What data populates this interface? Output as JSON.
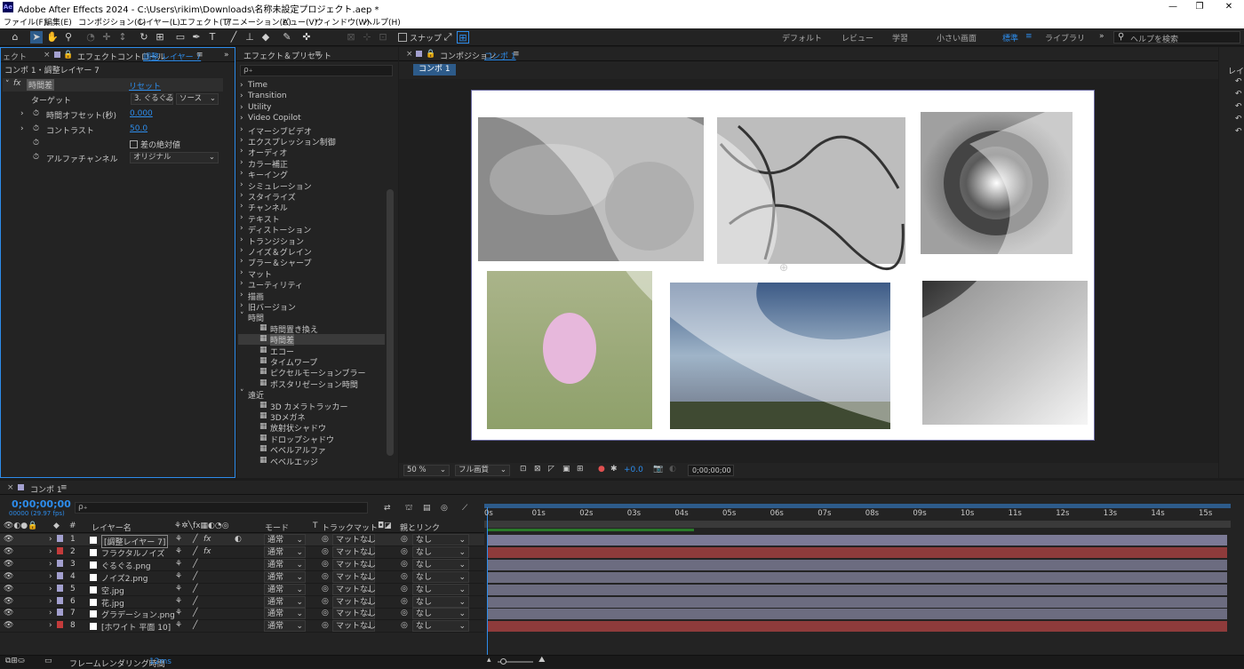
{
  "title_bar": {
    "title": "Adobe After Effects 2024 - C:\\Users\\rikim\\Downloads\\名称未設定プロジェクト.aep *",
    "logo": "Ae",
    "minimize": "—",
    "maximize": "❐",
    "close": "✕"
  },
  "menu": [
    "ファイル(F)",
    "編集(E)",
    "コンポジション(C)",
    "レイヤー(L)",
    "エフェクト(T)",
    "アニメーション(A)",
    "ビュー(V)",
    "ウィンドウ(W)",
    "ヘルプ(H)"
  ],
  "toolbar": {
    "snap_label": "スナップ",
    "workspaces": [
      "デフォルト",
      "レビュー",
      "学習",
      "小さい画面",
      "標準",
      "ライブラリ"
    ],
    "active_workspace": "標準",
    "help_search_placeholder": "ヘルプを検索"
  },
  "effect_controls": {
    "left_tab": "ェクト",
    "tab_label": "エフェクトコントロール",
    "tab_layer": "調整 レイヤー 7",
    "breadcrumb": "コンポ 1・調整レイヤー 7",
    "effect_name": "時間差",
    "reset_label": "リセット",
    "fx_label": "fx",
    "props": [
      {
        "label": "ターゲット",
        "value": "3. ぐるぐる",
        "value2": "ソース"
      },
      {
        "label": "時間オフセット(秒)",
        "value": "0.000"
      },
      {
        "label": "コントラスト",
        "value": "50.0"
      },
      {
        "label": "",
        "value": "差の絶対値"
      },
      {
        "label": "アルファチャンネル",
        "value": "オリジナル"
      }
    ]
  },
  "effects_presets": {
    "tab_label": "エフェクト＆プリセット",
    "search_placeholder": "ρ₊",
    "categories": [
      "Time",
      "Transition",
      "Utility",
      "Video Copilot",
      "イマーシブビデオ",
      "エクスプレッション制御",
      "オーディオ",
      "カラー補正",
      "キーイング",
      "シミュレーション",
      "スタイライズ",
      "チャンネル",
      "テキスト",
      "ディストーション",
      "トランジション",
      "ノイズ＆グレイン",
      "ブラー＆シャープ",
      "マット",
      "ユーティリティ",
      "描画",
      "旧バージョン"
    ],
    "expanded": "時間",
    "time_items": [
      "時間置き換え",
      "時間差",
      "エコー",
      "タイムワープ",
      "ピクセルモーションブラー",
      "ポスタリゼーション時間"
    ],
    "selected_item": "時間差",
    "obsolete_label": "遠近",
    "obsolete_items": [
      "3D カメラトラッカー",
      "3Dメガネ",
      "放射状シャドウ",
      "ドロップシャドウ",
      "ベベルアルファ",
      "ベベルエッジ"
    ]
  },
  "composition": {
    "tab_prefix": "コンポジション",
    "tab_name": "コンポ 1",
    "sub_tab": "コンポ 1",
    "zoom": "50 %",
    "resolution": "フル画質",
    "exposure": "+0.0",
    "timecode": "0;00;00;00"
  },
  "right_panel": {
    "label": "レイ"
  },
  "timeline": {
    "tab_label": "コンポ 1",
    "timecode": "0;00;00;00",
    "frame_info": "00000 (29.97 fps)",
    "search_placeholder": "ρ₊",
    "headers": {
      "num": "#",
      "name": "レイヤー名",
      "mode": "モード",
      "t": "T",
      "trackmatte": "トラックマット",
      "parent": "親とリンク"
    },
    "ruler": [
      "0s",
      "01s",
      "02s",
      "03s",
      "04s",
      "05s",
      "06s",
      "07s",
      "08s",
      "09s",
      "10s",
      "11s",
      "12s",
      "13s",
      "14s",
      "15s"
    ],
    "layers": [
      {
        "num": "1",
        "name": "[調整レイヤー 7]",
        "label_color": "#a3a0cf",
        "mode": "通常",
        "matte": "マットなし",
        "parent": "なし",
        "bar_color": "#7b7a96",
        "fx": "fx"
      },
      {
        "num": "2",
        "name": "フラクタルノイズ",
        "label_color": "#c33b3b",
        "mode": "通常",
        "matte": "マットなし",
        "parent": "なし",
        "bar_color": "#8e3b3b",
        "fx": "fx"
      },
      {
        "num": "3",
        "name": "ぐるぐる.png",
        "label_color": "#a3a0cf",
        "mode": "通常",
        "matte": "マットなし",
        "parent": "なし",
        "bar_color": "#6c6c80",
        "fx": ""
      },
      {
        "num": "4",
        "name": "ノイズ2.png",
        "label_color": "#a3a0cf",
        "mode": "通常",
        "matte": "マットなし",
        "parent": "なし",
        "bar_color": "#6c6c80",
        "fx": ""
      },
      {
        "num": "5",
        "name": "空.jpg",
        "label_color": "#a3a0cf",
        "mode": "通常",
        "matte": "マットなし",
        "parent": "なし",
        "bar_color": "#6c6c80",
        "fx": ""
      },
      {
        "num": "6",
        "name": "花.jpg",
        "label_color": "#a3a0cf",
        "mode": "通常",
        "matte": "マットなし",
        "parent": "なし",
        "bar_color": "#6c6c80",
        "fx": ""
      },
      {
        "num": "7",
        "name": "グラデーション.png",
        "label_color": "#a3a0cf",
        "mode": "通常",
        "matte": "マットなし",
        "parent": "なし",
        "bar_color": "#6c6c80",
        "fx": ""
      },
      {
        "num": "8",
        "name": "[ホワイト 平面 10]",
        "label_color": "#c33b3b",
        "mode": "通常",
        "matte": "マットなし",
        "parent": "なし",
        "bar_color": "#8e3b3b",
        "fx": ""
      }
    ],
    "status_label": "フレームレンダリング時間",
    "status_value": "12ms"
  },
  "colors": {
    "accent": "#2d8ceb",
    "panel": "#232323",
    "bg": "#1c1c1c"
  }
}
